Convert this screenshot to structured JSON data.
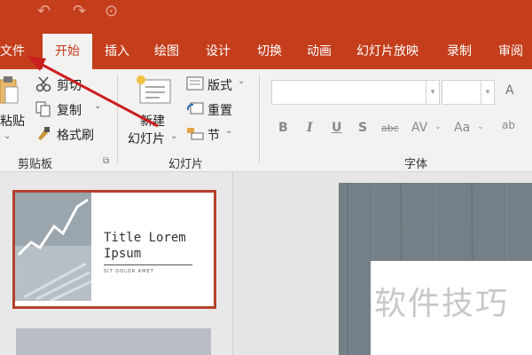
{
  "tabs": [
    {
      "label": "文件"
    },
    {
      "label": "开始"
    },
    {
      "label": "插入"
    },
    {
      "label": "绘图"
    },
    {
      "label": "设计"
    },
    {
      "label": "切换"
    },
    {
      "label": "动画"
    },
    {
      "label": "幻灯片放映"
    },
    {
      "label": "录制"
    },
    {
      "label": "审阅"
    }
  ],
  "active_tab": "开始",
  "clipboard": {
    "paste_label": "粘贴",
    "cut_label": "剪切",
    "copy_label": "复制",
    "format_painter_label": "格式刷",
    "group_label": "剪贴板"
  },
  "slides_group": {
    "new_slide_label_1": "新建",
    "new_slide_label_2": "幻灯片",
    "layout_label": "版式",
    "reset_label": "重置",
    "section_label": "节",
    "group_label": "幻灯片"
  },
  "font_group": {
    "font_name_value": "",
    "font_size_value": "",
    "group_label": "字体",
    "bold": "B",
    "italic": "I",
    "underline": "U",
    "shadow": "S",
    "strikethrough": "abc",
    "spacing": "AV",
    "change_case": "Aa",
    "grow_font": "A",
    "clear_format": "ab"
  },
  "thumbnail": {
    "title": "Title Lorem Ipsum",
    "subtitle": "SIT DOLOR AMET"
  },
  "watermark": "软件技巧",
  "colors": {
    "brand": "#c43e1c",
    "ribbon": "#f3f2f1",
    "selection": "#b5412a",
    "arrow": "#cc1f1f"
  }
}
